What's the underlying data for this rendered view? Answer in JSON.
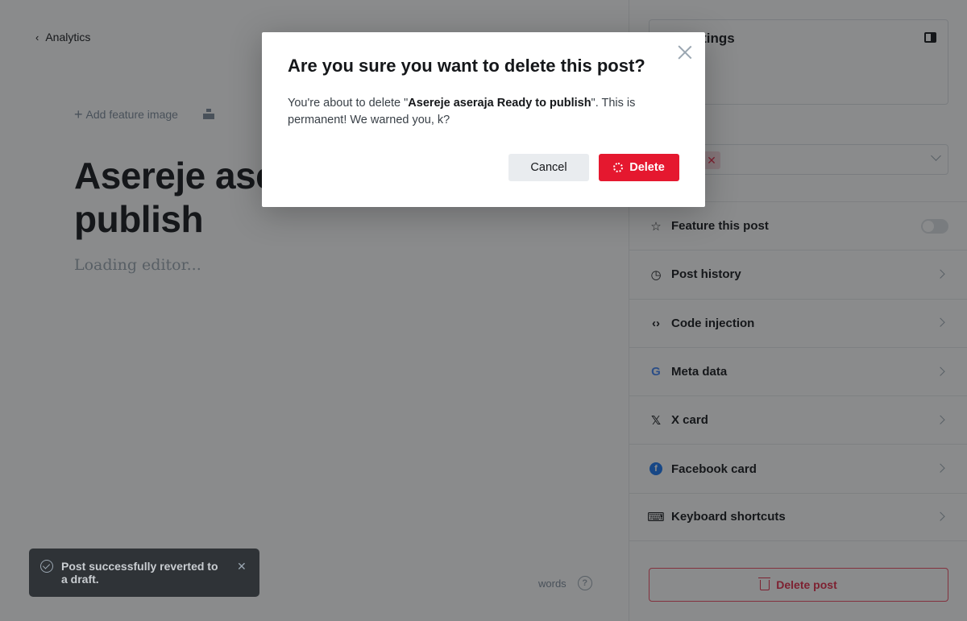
{
  "editor": {
    "back_label": "Analytics",
    "add_feature_image": "Add feature image",
    "post_title": "Asereje aseraja Ready to publish",
    "loading_text": "Loading editor...",
    "word_count_label": "words"
  },
  "sidebar": {
    "title": "Post settings",
    "items": [
      {
        "label": "Feature this post",
        "icon": "star-icon"
      },
      {
        "label": "Post history",
        "icon": "history-icon"
      },
      {
        "label": "Code injection",
        "icon": "code-icon"
      },
      {
        "label": "Meta data",
        "icon": "google-icon"
      },
      {
        "label": "X card",
        "icon": "x-icon"
      },
      {
        "label": "Facebook card",
        "icon": "facebook-icon"
      },
      {
        "label": "Keyboard shortcuts",
        "icon": "keyboard-icon"
      }
    ],
    "delete_label": "Delete post"
  },
  "modal": {
    "title": "Are you sure you want to delete this post?",
    "body_prefix": "You're about to delete \"",
    "post_name": "Asereje aseraja Ready to publish",
    "body_suffix": "\". This is permanent! We warned you, k?",
    "cancel_label": "Cancel",
    "delete_label": "Delete"
  },
  "toast": {
    "message": "Post successfully reverted to a draft."
  },
  "colors": {
    "danger": "#e5182f",
    "overlay": "rgba(21,23,26,0.5)"
  }
}
